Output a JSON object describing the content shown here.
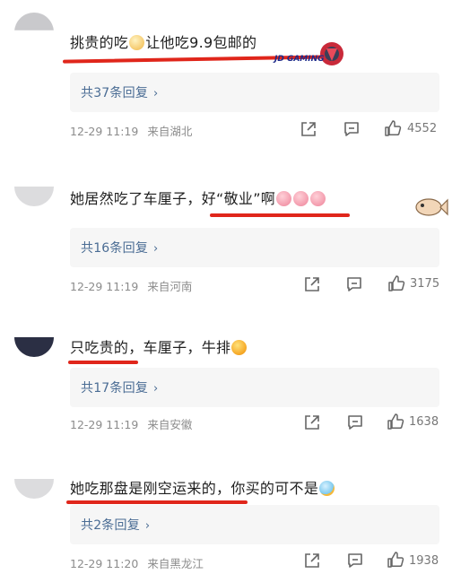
{
  "comments": [
    {
      "text_parts": [
        "挑贵的吃",
        "让他吃9.9包邮的"
      ],
      "badge_text": "JD GAMING",
      "replies_label": "共37条回复",
      "time": "12-29 11:19",
      "location": "来自湖北",
      "likes": "4552"
    },
    {
      "text_parts": [
        "她居然吃了车厘子，",
        "好“敬业”啊"
      ],
      "replies_label": "共16条回复",
      "time": "12-29 11:19",
      "location": "来自河南",
      "likes": "3175"
    },
    {
      "text_parts": [
        "只吃贵的",
        "，车厘子，牛排"
      ],
      "replies_label": "共17条回复",
      "time": "12-29 11:19",
      "location": "来自安徽",
      "likes": "1638"
    },
    {
      "text_parts": [
        "她吃那盘是刚空运来的",
        "，你买的可不是"
      ],
      "replies_label": "共2条回复",
      "time": "12-29 11:20",
      "location": "来自黑龙江",
      "likes": "1938"
    }
  ],
  "icons": {
    "share": "share-icon",
    "comment": "comment-icon",
    "like": "thumbs-up-icon",
    "reply_chevron": "chevron-right-icon"
  },
  "colors": {
    "reply_link": "#4a6c94",
    "underline": "#e0261b",
    "meta": "#8c8c8c"
  }
}
